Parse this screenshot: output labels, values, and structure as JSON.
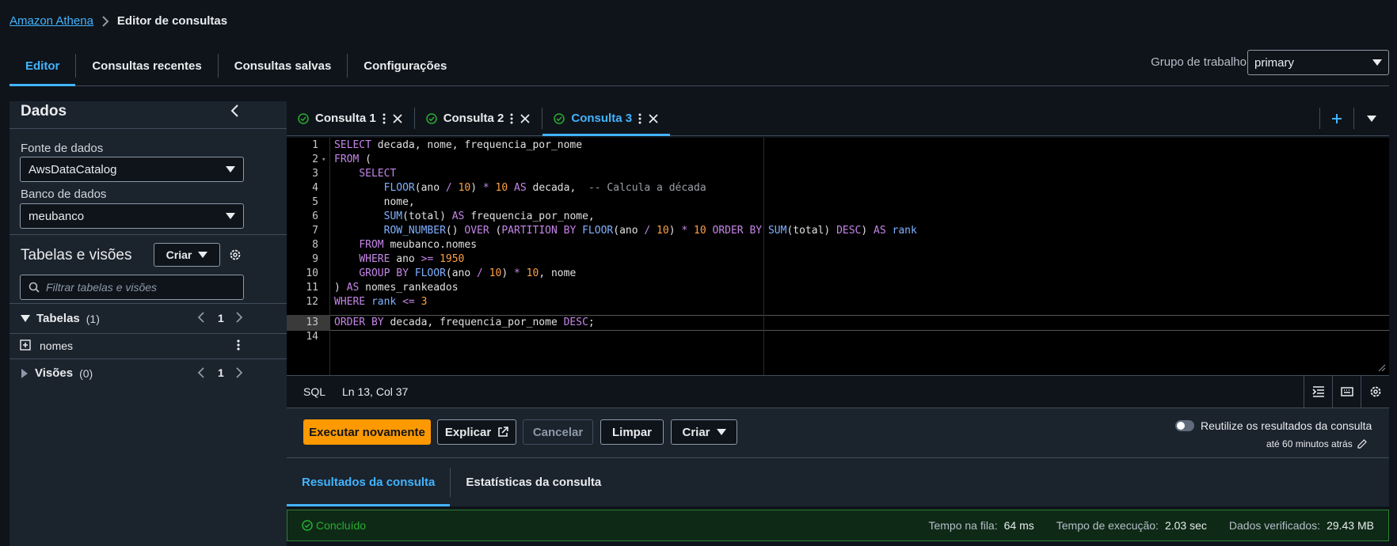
{
  "breadcrumb": {
    "root": "Amazon Athena",
    "current": "Editor de consultas"
  },
  "top_tabs": [
    "Editor",
    "Consultas recentes",
    "Consultas salvas",
    "Configurações"
  ],
  "workgroup": {
    "label": "Grupo de trabalho",
    "value": "primary"
  },
  "left_panel": {
    "title": "Dados",
    "datasource_label": "Fonte de dados",
    "datasource_value": "AwsDataCatalog",
    "database_label": "Banco de dados",
    "database_value": "meubanco",
    "tables_title": "Tabelas e visões",
    "create_label": "Criar",
    "filter_placeholder": "Filtrar tabelas e visões",
    "tables_section": "Tabelas",
    "tables_count": "(1)",
    "tables_page": "1",
    "table_item": "nomes",
    "views_section": "Visões",
    "views_count": "(0)",
    "views_page": "1"
  },
  "query_tabs": [
    "Consulta 1",
    "Consulta 2",
    "Consulta 3"
  ],
  "code_lines": [
    "1",
    "2",
    "3",
    "4",
    "5",
    "6",
    "7",
    "8",
    "9",
    "10",
    "11",
    "12",
    "13",
    "14"
  ],
  "status": {
    "lang": "SQL",
    "position": "Ln 13, Col 37"
  },
  "actions": {
    "run": "Executar novamente",
    "explain": "Explicar",
    "cancel": "Cancelar",
    "clear": "Limpar",
    "create": "Criar",
    "reuse_label": "Reutilize os resultados da consulta",
    "reuse_sub": "até 60 minutos atrás"
  },
  "results_tabs": [
    "Resultados da consulta",
    "Estatísticas da consulta"
  ],
  "result": {
    "status": "Concluído",
    "queue_label": "Tempo na fila:",
    "queue_value": "64 ms",
    "exec_label": "Tempo de execução:",
    "exec_value": "2.03 sec",
    "scanned_label": "Dados verificados:",
    "scanned_value": "29.43 MB"
  },
  "colors": {
    "accent": "#42b4ff",
    "primary_button": "#ff9900",
    "success": "#2e7d32"
  }
}
